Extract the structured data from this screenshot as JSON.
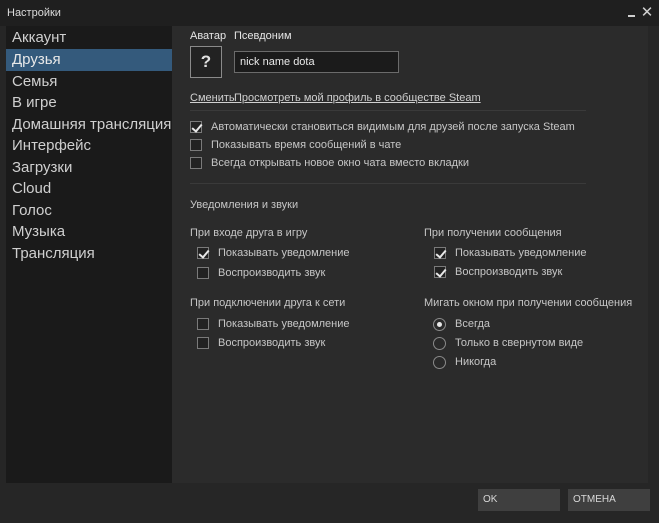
{
  "window": {
    "title": "Настройки",
    "close_glyph": "✕"
  },
  "sidebar": {
    "items": [
      {
        "label": "Аккаунт"
      },
      {
        "label": "Друзья"
      },
      {
        "label": "Семья"
      },
      {
        "label": "В игре"
      },
      {
        "label": "Домашняя трансляция"
      },
      {
        "label": "Интерфейс"
      },
      {
        "label": "Загрузки"
      },
      {
        "label": "Cloud"
      },
      {
        "label": "Голос"
      },
      {
        "label": "Музыка"
      },
      {
        "label": "Трансляция"
      }
    ],
    "active_index": 1
  },
  "profile": {
    "avatar_label": "Аватар",
    "avatar_placeholder": "?",
    "nickname_label": "Псевдоним",
    "nickname_value": "nick name dota",
    "change_link": "Сменить",
    "view_profile_link": "Просмотреть мой профиль в сообществе Steam"
  },
  "options": {
    "auto_visible": {
      "label": "Автоматически становиться видимым для друзей после запуска Steam",
      "checked": true
    },
    "show_timestamps": {
      "label": "Показывать время сообщений в чате",
      "checked": false
    },
    "new_window": {
      "label": "Всегда открывать новое окно чата вместо вкладки",
      "checked": false
    }
  },
  "notifications": {
    "heading": "Уведомления и звуки",
    "friend_joins_game": {
      "title": "При входе друга в игру",
      "show_notification": {
        "label": "Показывать уведомление",
        "checked": true
      },
      "play_sound": {
        "label": "Воспроизводить звук",
        "checked": false
      }
    },
    "message_received": {
      "title": "При получении сообщения",
      "show_notification": {
        "label": "Показывать уведомление",
        "checked": true
      },
      "play_sound": {
        "label": "Воспроизводить звук",
        "checked": true
      }
    },
    "friend_online": {
      "title": "При подключении друга к сети",
      "show_notification": {
        "label": "Показывать уведомление",
        "checked": false
      },
      "play_sound": {
        "label": "Воспроизводить звук",
        "checked": false
      }
    },
    "flash_window": {
      "title": "Мигать окном при получении сообщения",
      "options": [
        {
          "label": "Всегда",
          "selected": true
        },
        {
          "label": "Только в свернутом виде",
          "selected": false
        },
        {
          "label": "Никогда",
          "selected": false
        }
      ]
    }
  },
  "footer": {
    "ok_label": "OK",
    "cancel_label": "ОТМЕНА"
  },
  "colors": {
    "background": "#262626",
    "sidebar_bg": "#1a1a1a",
    "content_bg": "#2b2b2b",
    "active_item": "#345a7c",
    "button_bg": "#3f3f3f"
  }
}
